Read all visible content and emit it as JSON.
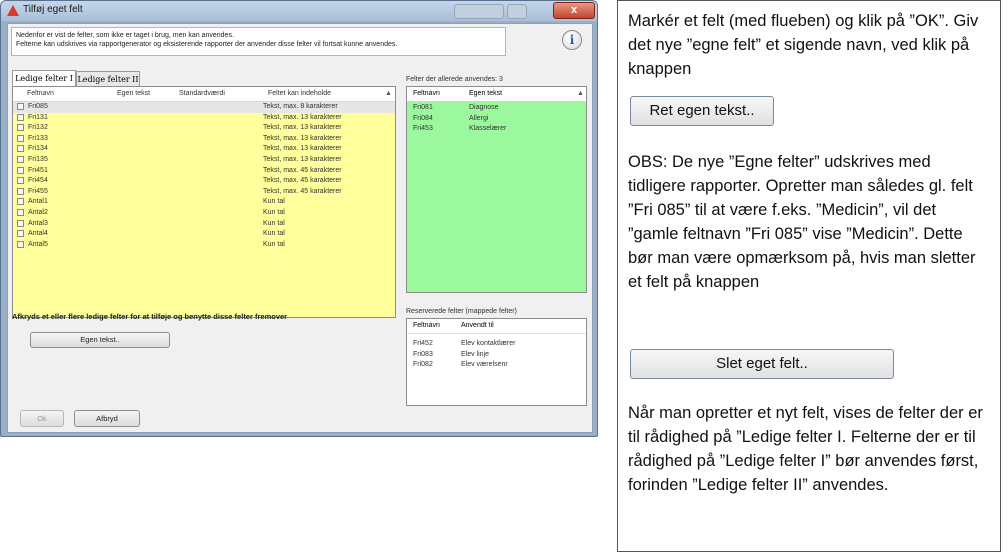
{
  "dialog": {
    "title": "Tilføj eget felt",
    "close_label": "x",
    "info_text_line1": "Nedenfor er vist de felter, som ikke er taget i brug, men kan anvendes.",
    "info_text_line2": "Felterne kan udskrives via rapportgenerator og eksisterende rapporter der anvender disse felter vil fortsat kunne anvendes.",
    "info_icon": "i",
    "tabs": [
      {
        "label": "Ledige felter I",
        "active": true
      },
      {
        "label": "Ledige felter II",
        "active": false
      }
    ],
    "free_fields": {
      "columns": [
        "Feltnavn",
        "Egen tekst",
        "Standardværdi",
        "Feltet kan indeholde"
      ],
      "rows": [
        {
          "name": "Fri085",
          "capacity": "Tekst, max. 8 karakterer",
          "selected": true
        },
        {
          "name": "Fri131",
          "capacity": "Tekst, max. 13 karakterer"
        },
        {
          "name": "Fri132",
          "capacity": "Tekst, max. 13 karakterer"
        },
        {
          "name": "Fri133",
          "capacity": "Tekst, max. 13 karakterer"
        },
        {
          "name": "Fri134",
          "capacity": "Tekst, max. 13 karakterer"
        },
        {
          "name": "Fri135",
          "capacity": "Tekst, max. 13 karakterer"
        },
        {
          "name": "Fri451",
          "capacity": "Tekst, max. 45 karakterer"
        },
        {
          "name": "Fri454",
          "capacity": "Tekst, max. 45 karakterer"
        },
        {
          "name": "Fri455",
          "capacity": "Tekst, max. 45 karakterer"
        },
        {
          "name": "Antal1",
          "capacity": "Kun tal"
        },
        {
          "name": "Antal2",
          "capacity": "Kun tal"
        },
        {
          "name": "Antal3",
          "capacity": "Kun tal"
        },
        {
          "name": "Antal4",
          "capacity": "Kun tal"
        },
        {
          "name": "Antal5",
          "capacity": "Kun tal"
        }
      ]
    },
    "used_fields": {
      "label": "Felter der allerede anvendes: 3",
      "columns": [
        "Feltnavn",
        "Egen tekst"
      ],
      "rows": [
        {
          "name": "Fri081",
          "text": "Diagnose"
        },
        {
          "name": "Fri084",
          "text": "Allergi"
        },
        {
          "name": "Fri453",
          "text": "Klasselærer"
        }
      ]
    },
    "reserved_fields": {
      "label": "Reserverede felter (mappede felter)",
      "columns": [
        "Feltnavn",
        "Anvendt til"
      ],
      "rows": [
        {
          "name": "Fri452",
          "text": "Elev kontaktlærer"
        },
        {
          "name": "Fri083",
          "text": "Elev linje"
        },
        {
          "name": "Fri082",
          "text": "Elev værelsenr"
        }
      ]
    },
    "note": "Afkryds et eller flere ledige felter for at tilføje og benytte disse felter fremover",
    "own_text_button": "Egen tekst..",
    "ok_button": "Ok",
    "cancel_button": "Afbryd"
  },
  "panel": {
    "para1": "Markér et felt (med flueben) og klik på ”OK”.  Giv det nye ”egne felt” et sigende navn, ved klik på knappen",
    "button1": "Ret egen tekst..",
    "para2": "OBS: De nye ”Egne felter” udskrives med tidligere rapporter. Opretter man således gl. felt ”Fri 085” til at være f.eks. ”Medicin”, vil det ”gamle feltnavn ”Fri 085” vise ”Medicin”. Dette bør man være opmærksom på, hvis man sletter et felt på knappen",
    "button2": "Slet eget felt..",
    "para3": "Når man opretter et nyt felt, vises de felter der er til rådighed på ”Ledige felter I. Felterne der er til rådighed på ”Ledige felter I” bør anvendes først, forinden ”Ledige felter II” anvendes."
  },
  "colors": {
    "free_grid": "#ffff9c",
    "used_grid": "#9cf89c",
    "title_icon": "#d93a2a"
  }
}
